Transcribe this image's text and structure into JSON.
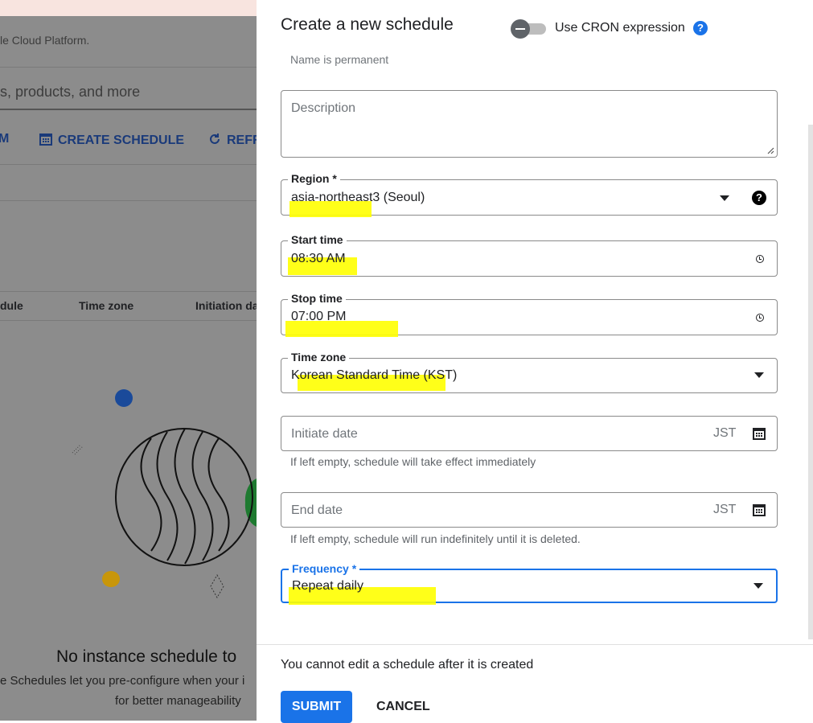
{
  "background": {
    "platform_text": "le Cloud Platform.",
    "search_placeholder": "s, products, and more",
    "action_1": "M",
    "action_create": "CREATE SCHEDULE",
    "action_refresh": "REFR",
    "columns": [
      "dule",
      "Time zone",
      "Initiation da"
    ],
    "empty_title": "No instance schedule to",
    "empty_sub_1": "e Schedules let you pre-configure when your i",
    "empty_sub_2": "for better manageability"
  },
  "dialog": {
    "title": "Create a new schedule",
    "cron_label": "Use CRON expression",
    "name_hint": "Name is permanent",
    "description_placeholder": "Description",
    "region": {
      "label": "Region *",
      "value": "asia-northeast3 (Seoul)"
    },
    "start_time": {
      "label": "Start time",
      "value": "08:30 AM"
    },
    "stop_time": {
      "label": "Stop time",
      "value": "07:00 PM"
    },
    "time_zone": {
      "label": "Time zone",
      "value": "Korean Standard Time (KST)"
    },
    "initiate_date": {
      "placeholder": "Initiate date",
      "tz": "JST",
      "hint": "If left empty, schedule will take effect immediately"
    },
    "end_date": {
      "placeholder": "End date",
      "tz": "JST",
      "hint": "If left empty, schedule will run indefinitely until it is deleted."
    },
    "frequency": {
      "label": "Frequency *",
      "value": "Repeat daily"
    },
    "note": "You cannot edit a schedule after it is created",
    "submit_label": "SUBMIT",
    "cancel_label": "CANCEL"
  },
  "colors": {
    "accent": "#1a73e8",
    "highlight": "#ffff00"
  }
}
